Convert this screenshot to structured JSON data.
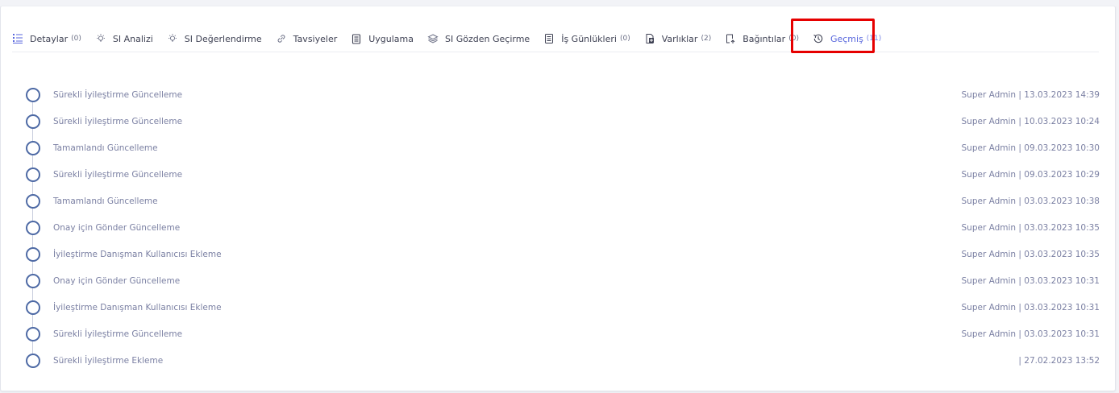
{
  "tabs": [
    {
      "label": "Detaylar",
      "count": "(0)",
      "icon": "list-icon",
      "active": false
    },
    {
      "label": "SI Analizi",
      "count": "",
      "icon": "lightbulb-icon",
      "active": false
    },
    {
      "label": "SI Değerlendirme",
      "count": "",
      "icon": "lightbulb-icon",
      "active": false
    },
    {
      "label": "Tavsiyeler",
      "count": "",
      "icon": "link-icon",
      "active": false
    },
    {
      "label": "Uygulama",
      "count": "",
      "icon": "clipboard-icon",
      "active": false
    },
    {
      "label": "SI Gözden Geçirme",
      "count": "",
      "icon": "layers-icon",
      "active": false
    },
    {
      "label": "İş Günlükleri",
      "count": "(0)",
      "icon": "notebook-icon",
      "active": false
    },
    {
      "label": "Varlıklar",
      "count": "(2)",
      "icon": "document-add-icon",
      "active": false
    },
    {
      "label": "Bağıntılar",
      "count": "(0)",
      "icon": "relation-icon",
      "active": false
    },
    {
      "label": "Geçmiş",
      "count": "(11)",
      "icon": "history-icon",
      "active": true
    }
  ],
  "accent_color": "#5867dd",
  "highlight_color": "#e60000",
  "history": [
    {
      "text": "Sürekli İyileştirme Güncelleme",
      "meta": "Super Admin | 13.03.2023 14:39"
    },
    {
      "text": "Sürekli İyileştirme Güncelleme",
      "meta": "Super Admin | 10.03.2023 10:24"
    },
    {
      "text": "Tamamlandı Güncelleme",
      "meta": "Super Admin | 09.03.2023 10:30"
    },
    {
      "text": "Sürekli İyileştirme Güncelleme",
      "meta": "Super Admin | 09.03.2023 10:29"
    },
    {
      "text": "Tamamlandı Güncelleme",
      "meta": "Super Admin | 03.03.2023 10:38"
    },
    {
      "text": "Onay için Gönder Güncelleme",
      "meta": "Super Admin | 03.03.2023 10:35"
    },
    {
      "text": "İyileştirme Danışman Kullanıcısı Ekleme",
      "meta": "Super Admin | 03.03.2023 10:35"
    },
    {
      "text": "Onay için Gönder Güncelleme",
      "meta": "Super Admin | 03.03.2023 10:31"
    },
    {
      "text": "İyileştirme Danışman Kullanıcısı Ekleme",
      "meta": "Super Admin | 03.03.2023 10:31"
    },
    {
      "text": "Sürekli İyileştirme Güncelleme",
      "meta": "Super Admin | 03.03.2023 10:31"
    },
    {
      "text": "Sürekli İyileştirme Ekleme",
      "meta": "| 27.02.2023 13:52"
    }
  ]
}
